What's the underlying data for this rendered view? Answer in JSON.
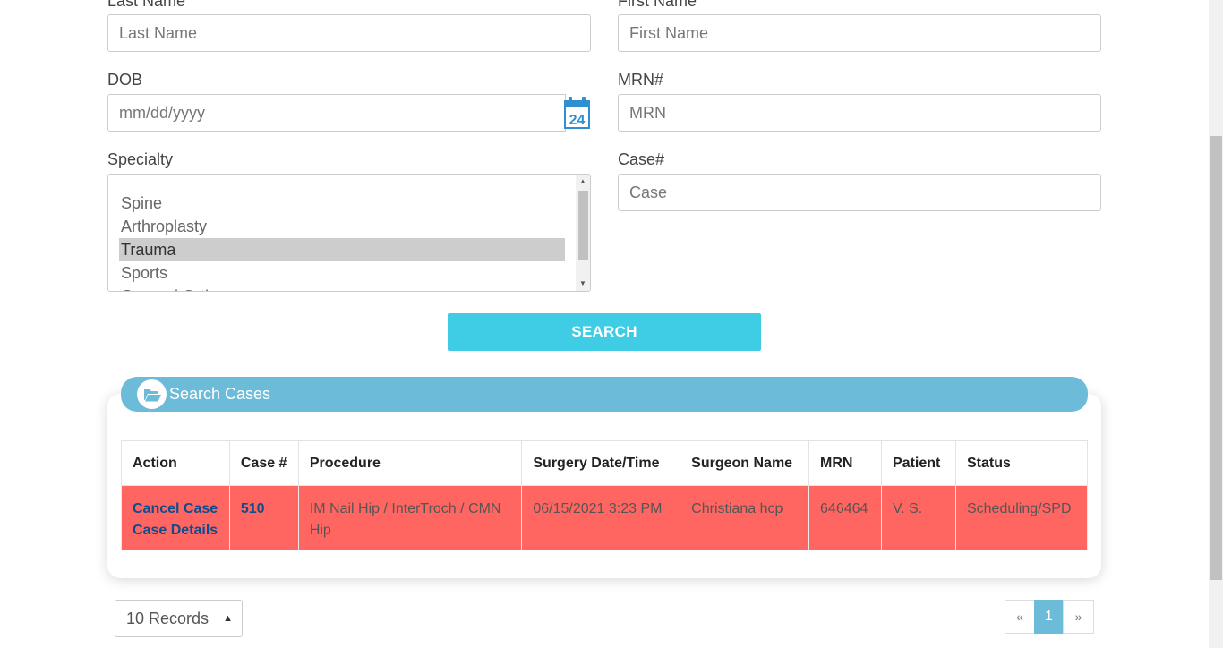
{
  "form": {
    "last_name": {
      "label": "Last Name",
      "placeholder": "Last Name"
    },
    "first_name": {
      "label": "First Name",
      "placeholder": "First Name"
    },
    "dob": {
      "label": "DOB",
      "placeholder": "mm/dd/yyyy",
      "calendar_day": "24"
    },
    "mrn": {
      "label": "MRN#",
      "placeholder": "MRN"
    },
    "specialty": {
      "label": "Specialty",
      "options": [
        "Spine",
        "Arthroplasty",
        "Trauma",
        "Sports",
        "General Orth..."
      ],
      "selected": "Trauma"
    },
    "case": {
      "label": "Case#",
      "placeholder": "Case"
    },
    "search_button": "SEARCH"
  },
  "results": {
    "title": "Search Cases",
    "columns": [
      "Action",
      "Case #",
      "Procedure",
      "Surgery Date/Time",
      "Surgeon Name",
      "MRN",
      "Patient",
      "Status"
    ],
    "rows": [
      {
        "actions": [
          "Cancel Case",
          "Case Details"
        ],
        "case_num": "510",
        "procedure": "IM Nail Hip / InterTroch / CMN Hip",
        "surgery_datetime": "06/15/2021 3:23 PM",
        "surgeon": "Christiana hcp",
        "mrn": "646464",
        "patient": "V. S.",
        "status": "Scheduling/SPD",
        "row_color": "#ff6662"
      }
    ]
  },
  "footer": {
    "records_select": "10 Records",
    "pagination": {
      "prev": "«",
      "current": "1",
      "next": "»"
    }
  },
  "colors": {
    "accent": "#3ecde4",
    "header": "#6cbcd9",
    "link": "#0f4c8c"
  }
}
